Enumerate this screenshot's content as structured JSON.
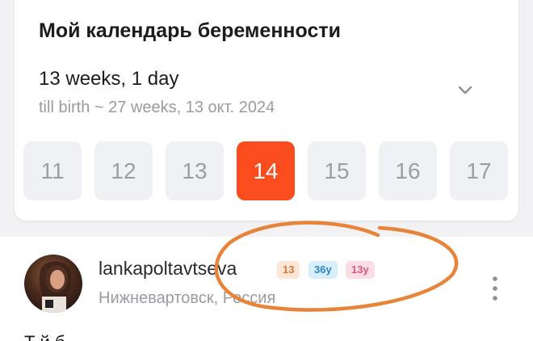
{
  "calendar": {
    "title": "Мой календарь беременности",
    "week_main": "13 weeks, 1 day",
    "week_sub": "till birth ~ 27 weeks, 13 окт. 2024",
    "weeks": [
      "11",
      "12",
      "13",
      "14",
      "15",
      "16",
      "17"
    ],
    "active_week": "14",
    "accent": "#fa4c1c"
  },
  "post": {
    "username": "lankapoltavtseva",
    "badges": [
      "13",
      "36у",
      "13у"
    ],
    "location": "Нижневартовск, Россия",
    "next_text": "Т          й                    б"
  },
  "annotation": {
    "color": "#e8843a"
  }
}
